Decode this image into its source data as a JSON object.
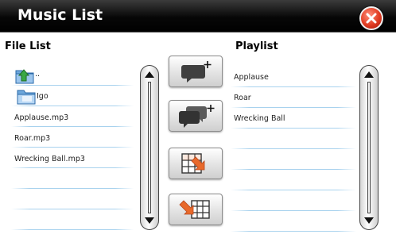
{
  "window": {
    "title": "Music List"
  },
  "headers": {
    "file_list": "File List",
    "playlist": "Playlist"
  },
  "file_list": {
    "items": [
      {
        "label": "..",
        "icon": "folder-up-icon"
      },
      {
        "label": "Igo",
        "icon": "folder-icon"
      },
      {
        "label": "Applause.mp3",
        "icon": ""
      },
      {
        "label": "Roar.mp3",
        "icon": ""
      },
      {
        "label": "Wrecking Ball.mp3",
        "icon": ""
      }
    ]
  },
  "playlist": {
    "items": [
      {
        "label": "Applause"
      },
      {
        "label": "Roar"
      },
      {
        "label": "Wrecking Ball"
      }
    ]
  },
  "actions": [
    {
      "name": "add-one-button",
      "icon": "speech-bubble-plus-icon"
    },
    {
      "name": "add-all-button",
      "icon": "speech-bubbles-plus-icon"
    },
    {
      "name": "remove-one-button",
      "icon": "table-arrow-right-icon"
    },
    {
      "name": "remove-all-button",
      "icon": "table-arrow-left-icon"
    }
  ],
  "colors": {
    "accent_orange": "#e8692b",
    "close_red": "#e03b21",
    "divider_blue": "#a8d2ee",
    "titlebar_black": "#000000"
  }
}
